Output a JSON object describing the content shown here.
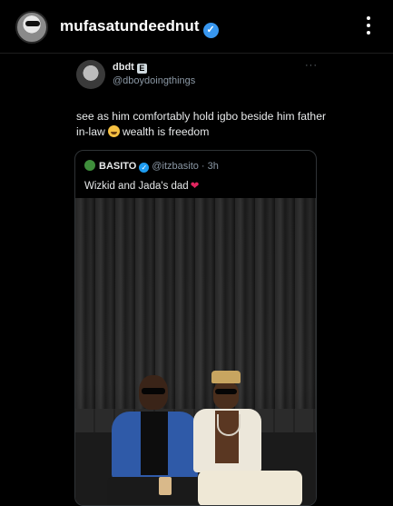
{
  "post": {
    "username": "mufasatundeednut",
    "verified_glyph": "✓",
    "more_icon": "more-vertical-icon"
  },
  "tweet": {
    "name": "dbdt",
    "badge": "E",
    "handle": "@dboydoingthings",
    "more": "···",
    "text_before_emoji": "see as him comfortably hold igbo beside him father in-law",
    "text_after_emoji": "wealth is freedom",
    "emoji": "laughing-emoji"
  },
  "quoted": {
    "name": "BASITO",
    "handle": "@itzbasito · 3h",
    "verified_glyph": "✓",
    "text": "Wizkid and Jada's dad",
    "heart": "❤"
  },
  "colors": {
    "background": "#000000",
    "instagram_verified": "#3897f0",
    "twitter_verified": "#1d9bf0",
    "heart": "#e0245e"
  }
}
